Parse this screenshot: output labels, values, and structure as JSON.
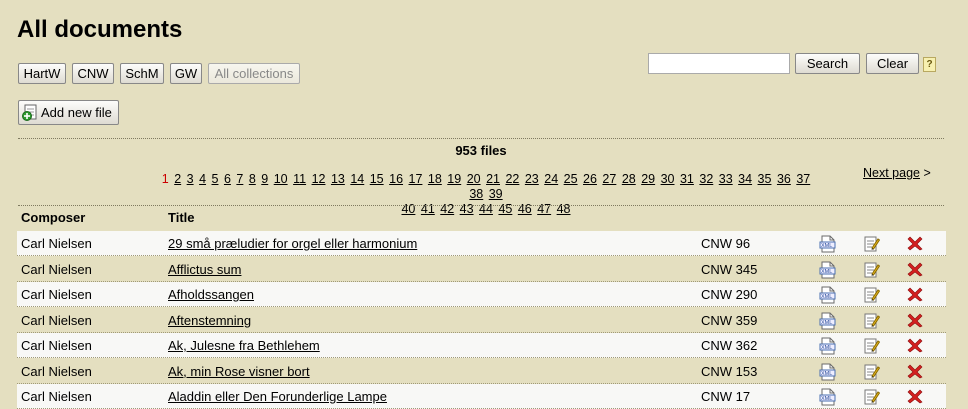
{
  "page": {
    "title": "All documents"
  },
  "collections": [
    "HartW",
    "CNW",
    "SchM",
    "GW",
    "All collections"
  ],
  "search": {
    "value": "",
    "search_label": "Search",
    "clear_label": "Clear",
    "help_label": "?"
  },
  "add_file_label": "Add new file",
  "file_count": "953 files",
  "pagination": {
    "current": "1",
    "pages": [
      "2",
      "3",
      "4",
      "5",
      "6",
      "7",
      "8",
      "9",
      "10",
      "11",
      "12",
      "13",
      "14",
      "15",
      "16",
      "17",
      "18",
      "19",
      "20",
      "21",
      "22",
      "23",
      "24",
      "25",
      "26",
      "27",
      "28",
      "29",
      "30",
      "31",
      "32",
      "33",
      "34",
      "35",
      "36",
      "37",
      "38",
      "39",
      "40",
      "41",
      "42",
      "43",
      "44",
      "45",
      "46",
      "47",
      "48"
    ],
    "next_label": "Next page",
    "next_arrow": ">"
  },
  "table": {
    "headers": {
      "composer": "Composer",
      "title": "Title"
    },
    "rows": [
      {
        "composer": "Carl Nielsen",
        "title": "29 små præludier for orgel eller harmonium",
        "cnw": "CNW 96"
      },
      {
        "composer": "Carl Nielsen",
        "title": "Afflictus sum",
        "cnw": "CNW 345"
      },
      {
        "composer": "Carl Nielsen",
        "title": "Afholdssangen",
        "cnw": "CNW 290"
      },
      {
        "composer": "Carl Nielsen",
        "title": "Aftenstemning",
        "cnw": "CNW 359"
      },
      {
        "composer": "Carl Nielsen",
        "title": "Ak, Julesne fra Bethlehem",
        "cnw": "CNW 362"
      },
      {
        "composer": "Carl Nielsen",
        "title": "Ak, min Rose visner bort",
        "cnw": "CNW 153"
      },
      {
        "composer": "Carl Nielsen",
        "title": "Aladdin eller Den Forunderlige Lampe",
        "cnw": "CNW 17"
      }
    ],
    "row_icons": [
      "xml-file-icon",
      "edit-document-icon",
      "delete-x-icon"
    ],
    "icon_xml_text": "XML"
  },
  "colors": {
    "background": "#e4dfc0",
    "current_page": "#cc0000",
    "delete": "#d42020"
  }
}
